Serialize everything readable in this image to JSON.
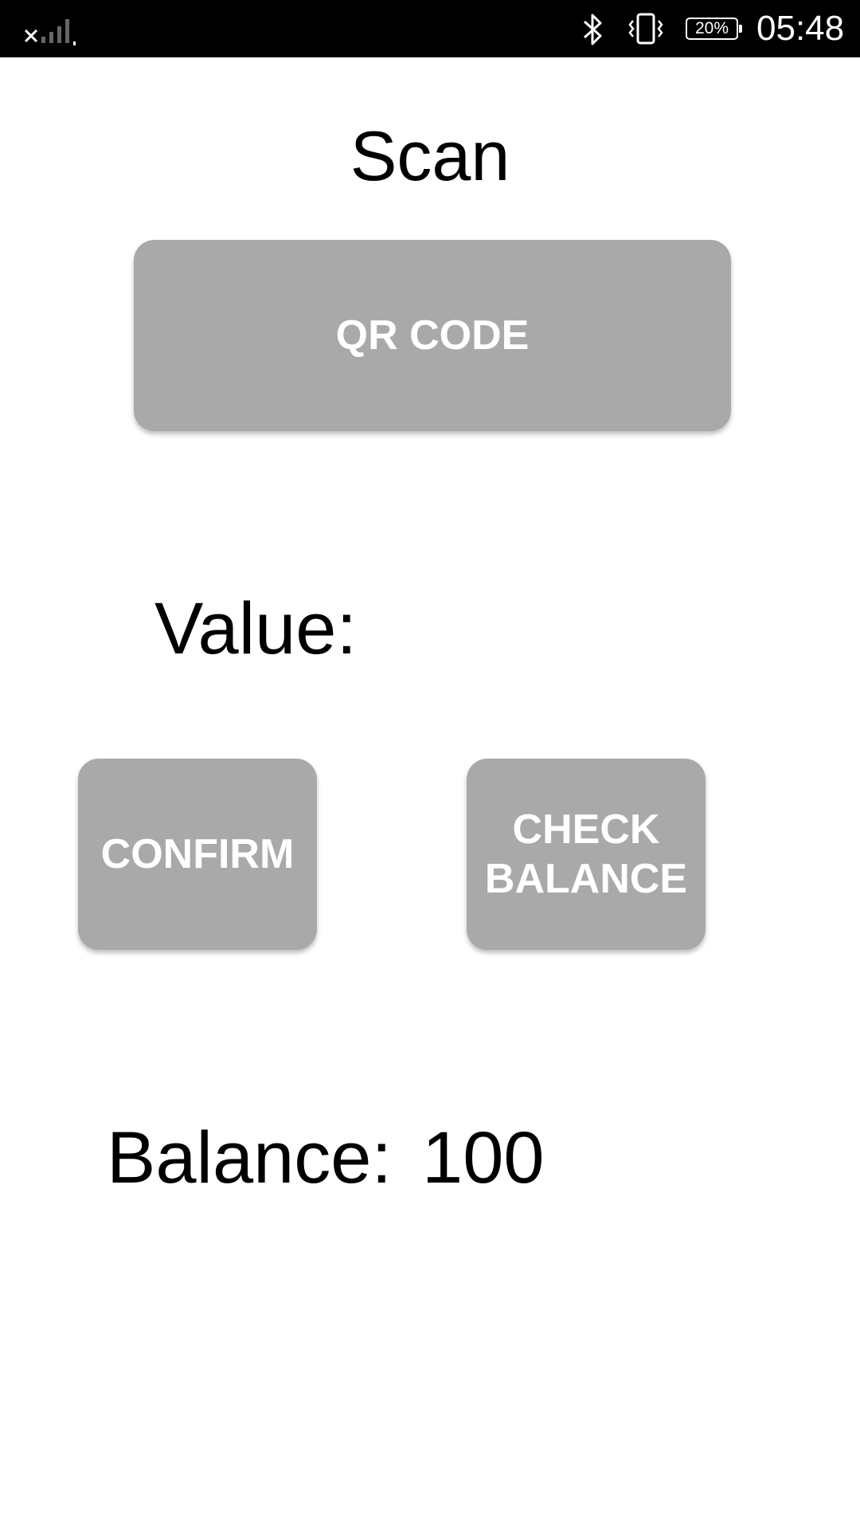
{
  "status_bar": {
    "battery_text": "20%",
    "time": "05:48",
    "icons": [
      "no-sim-signal-icon",
      "bluetooth-icon",
      "vibrate-icon",
      "battery-icon"
    ]
  },
  "screen": {
    "title": "Scan",
    "qr_button_label": "QR CODE",
    "value_label": "Value:",
    "confirm_button_label": "CONFIRM",
    "check_balance_button_label": "CHECK BALANCE",
    "balance_label": "Balance:",
    "balance_value": "100"
  },
  "colors": {
    "button_bg": "#a9a9a9",
    "button_text": "#ffffff",
    "status_bar_bg": "#000000",
    "background": "#ffffff"
  }
}
